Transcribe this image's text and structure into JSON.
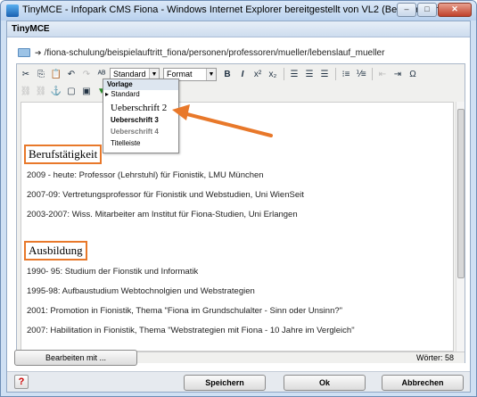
{
  "window": {
    "title": "TinyMCE - Infopark CMS Fiona - Windows Internet Explorer bereitgestellt von VL2 (Benutzerservice)"
  },
  "app": {
    "title": "TinyMCE",
    "path": "/fiona-schulung/beispielauftritt_fiona/personen/professoren/mueller/lebenslauf_mueller"
  },
  "toolbar": {
    "style_select": "Standard",
    "format_select": "Format"
  },
  "dropdown": {
    "header": "Vorlage",
    "items": [
      "Standard",
      "Ueberschrift 2",
      "Ueberschrift 3",
      "Ueberschrift 4",
      "Titelleiste"
    ]
  },
  "content": {
    "heading1": "Berufstätigkeit",
    "lines1": [
      "2009 - heute: Professor (Lehrstuhl) für Fionistik, LMU München",
      "2007-09: Vertretungsprofessor für Fionistik und Webstudien, Uni WienSeit",
      "2003-2007: Wiss. Mitarbeiter am Institut für Fiona-Studien, Uni Erlangen"
    ],
    "heading2": "Ausbildung",
    "lines2": [
      "1990- 95: Studium der Fionstik und Informatik",
      "1995-98: Aufbaustudium Webtochnolgien und Webstrategien",
      "2001: Promotion in Fionistik, Thema \"Fiona im Grundschulalter - Sinn oder Unsinn?\"",
      "2007: Habilitation in Fionistik, Thema \"Webstrategien mit Fiona - 10 Jahre im Vergleich\""
    ]
  },
  "status": {
    "wordcount": "Wörter: 58"
  },
  "buttons": {
    "edit_with": "Bearbeiten mit ...",
    "save": "Speichern",
    "ok": "Ok",
    "cancel": "Abbrechen"
  },
  "colors": {
    "accent": "#e8782a"
  }
}
